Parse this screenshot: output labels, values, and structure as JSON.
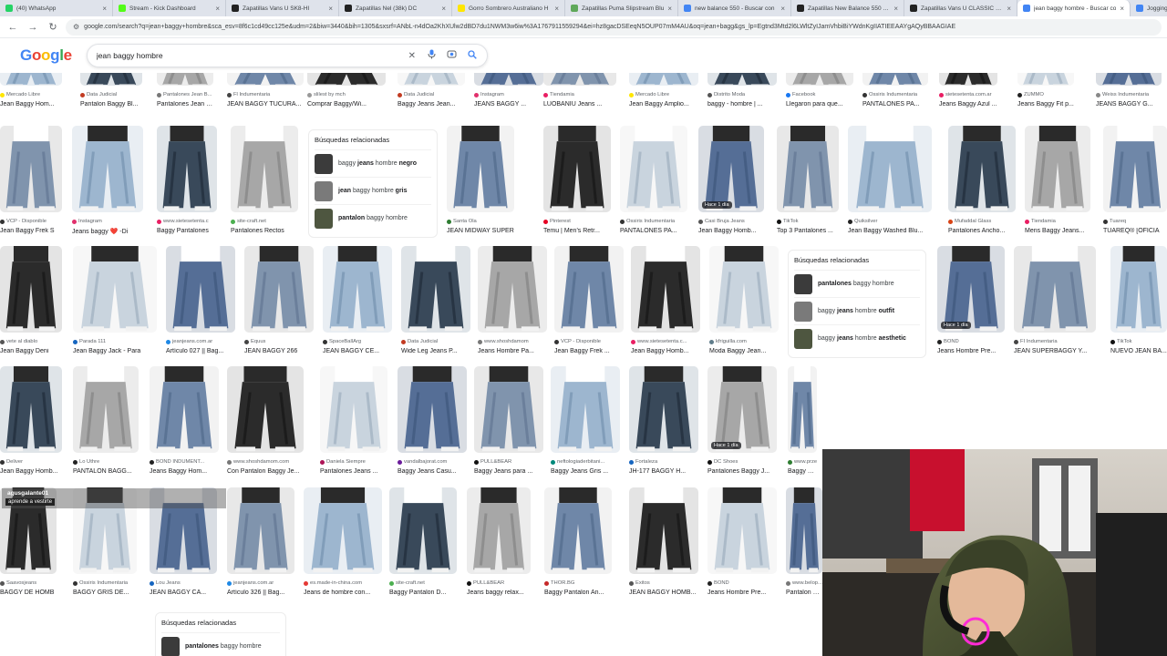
{
  "browser": {
    "tabs": [
      {
        "label": "(40) WhatsApp",
        "color": "#25d366",
        "active": false
      },
      {
        "label": "Stream - Kick Dashboard",
        "color": "#53fc18",
        "active": false
      },
      {
        "label": "Zapatillas Vans U SK8-HI",
        "color": "#222222",
        "active": false
      },
      {
        "label": "Zapatillas Nel (38k) DC",
        "color": "#222222",
        "active": false
      },
      {
        "label": "Gorro Sombrero Australiano H",
        "color": "#ffe600",
        "active": false
      },
      {
        "label": "Zapatillas Puma Slipstream Blu",
        "color": "#5fa85a",
        "active": false
      },
      {
        "label": "new balance 550 - Buscar con",
        "color": "#4285f4",
        "active": false
      },
      {
        "label": "Zapatillas New Balance 550 - B",
        "color": "#222222",
        "active": false
      },
      {
        "label": "Zapatillas Vans U CLASSIC SLI",
        "color": "#222222",
        "active": false
      },
      {
        "label": "jean baggy hombre - Buscar co",
        "color": "#4285f4",
        "active": true
      },
      {
        "label": "Jogging Co",
        "color": "#4285f4",
        "active": false
      }
    ],
    "url": "google.com/search?q=jean+baggy+hombre&sca_esv=8f6c1cd49cc125e&udm=2&biw=3440&bih=1305&sxsrf=ANbL-n4dOa2KhXUlw2dBD7du1NWM3w6iw%3A1767911559294&ei=hz8gacDSEeqN5OUP07mM4AU&oq=jean+bagg&gs_lp=Egtnd3Mtd2l6LWltZyIJamVhbiBiYWdnKgIIATIEEAAYgAQyBBAAGIAE"
  },
  "google": {
    "logo": "Google",
    "query": "jean baggy hombre"
  },
  "related": {
    "heading": "Búsquedas relacionadas",
    "box1": [
      {
        "pre": "baggy ",
        "bold": "jeans",
        "post": " hombre ",
        "bold2": "negro"
      },
      {
        "pre": "",
        "bold": "jean",
        "post": " baggy hombre ",
        "bold2": "gris"
      },
      {
        "pre": "",
        "bold": "pantalon",
        "post": " baggy hombre",
        "bold2": ""
      }
    ],
    "box2": [
      {
        "pre": "",
        "bold": "pantalones",
        "post": " baggy hombre",
        "bold2": ""
      },
      {
        "pre": "baggy ",
        "bold": "jeans",
        "post": " hombre ",
        "bold2": "outfit"
      },
      {
        "pre": "baggy ",
        "bold": "jeans",
        "post": " hombre ",
        "bold2": "aesthetic"
      }
    ],
    "box3": [
      {
        "pre": "",
        "bold": "pantalones",
        "post": " baggy hombre",
        "bold2": ""
      }
    ]
  },
  "rows": [
    [
      {
        "src": "Mercado Libre",
        "title": "Jean Baggy Hom...",
        "dot": "#ffe600"
      },
      {
        "src": "Data Judicial",
        "title": "Pantalon Baggy Bl...",
        "dot": "#c23b22"
      },
      {
        "src": "Pantalones Jean B...",
        "title": "Pantalones Jean B...",
        "dot": "#777777"
      },
      {
        "src": "Fl Indumentaria",
        "title": "JEAN BAGGY TUCURA...",
        "dot": "#444444"
      },
      {
        "src": "slilest by mch",
        "title": "Comprar Baggy/Wi...",
        "dot": "#999999"
      },
      {
        "src": "Data Judicial",
        "title": "Baggy Jeans Jean...",
        "dot": "#c23b22"
      },
      {
        "src": "Instagram",
        "title": "JEANS BAGGY ...",
        "dot": "#e1306c"
      },
      {
        "src": "Tiendamia",
        "title": "LUOBANIU Jeans ...",
        "dot": "#e91e63"
      },
      {
        "src": "Mercado Libre",
        "title": "Jean Baggy Amplio...",
        "dot": "#ffe600"
      },
      {
        "src": "Distrito Moda",
        "title": "baggy - hombre | ...",
        "dot": "#555555"
      },
      {
        "src": "Facebook",
        "title": "Llegaron para que...",
        "dot": "#1877f2"
      },
      {
        "src": "Ossiris Indumentaria",
        "title": "PANTALONES PA...",
        "dot": "#333333"
      },
      {
        "src": "sietesetenta.com.ar",
        "title": "Jeans Baggy Azul ...",
        "dot": "#e91e63"
      },
      {
        "src": "ZUMMO",
        "title": "Jeans Baggy Fit p...",
        "dot": "#222222"
      },
      {
        "src": "Weiss Indumentaria",
        "title": "JEANS BAGGY G...",
        "dot": "#888888"
      }
    ],
    [
      {
        "src": "VCP - Disponible",
        "title": "Jean Baggy Frek S",
        "dot": "#333333"
      },
      {
        "src": "Instagram",
        "title": "Jeans baggy ❤️ -Di",
        "dot": "#e1306c"
      },
      {
        "src": "www.sietesetenta.c",
        "title": "Baggy Pantalones",
        "dot": "#e91e63"
      },
      {
        "src": "site-craft.net",
        "title": "Pantalones Rectos",
        "dot": "#4caf50"
      },
      {
        "src": "Santa Ola",
        "title": "JEAN MIDWAY SUPER",
        "dot": "#2e7d32"
      },
      {
        "src": "Pinterest",
        "title": "Temu | Men's Retr...",
        "dot": "#e60023"
      },
      {
        "src": "Ossiris Indumentaria",
        "title": "PANTALONES PA...",
        "dot": "#333333"
      },
      {
        "src": "Casi Bruja Jeans",
        "title": "Jean Baggy Homb...",
        "dot": "#555555"
      },
      {
        "src": "TikTok",
        "title": "Top 3 Pantalones ...",
        "dot": "#111111"
      },
      {
        "src": "Quiksilver",
        "title": "Jean Baggy Washed Blu...",
        "dot": "#222222"
      },
      {
        "src": "Mufaddal Glass",
        "title": "Pantalones Ancho...",
        "dot": "#d84315"
      },
      {
        "src": "Tiendamia",
        "title": "Mens Baggy Jeans...",
        "dot": "#e91e63"
      },
      {
        "src": "Tuareq",
        "title": "TUAREQ® [OFICIA",
        "dot": "#333333"
      }
    ],
    [
      {
        "src": "vete al diablo",
        "title": "Jean Baggy Deni",
        "dot": "#555555"
      },
      {
        "src": "Parada 111",
        "title": "Jean Baggy Jack - Para",
        "dot": "#1565c0"
      },
      {
        "src": "jeanjeans.com.ar",
        "title": "Artículo 027 || Bag...",
        "dot": "#1e88e5"
      },
      {
        "src": "Equus",
        "title": "JEAN BAGGY 266",
        "dot": "#444444"
      },
      {
        "src": "SpaceBallArg",
        "title": "JEAN BAGGY CE...",
        "dot": "#333333"
      },
      {
        "src": "Data Judicial",
        "title": "Wide Leg Jeans P...",
        "dot": "#c23b22"
      },
      {
        "src": "www.shoshdamom",
        "title": "Jeans Hombre Pa...",
        "dot": "#777777"
      },
      {
        "src": "VCP - Disponible",
        "title": "Jean Baggy Frek ...",
        "dot": "#333333"
      },
      {
        "src": "www.sietesetenta.c...",
        "title": "Jean Baggy Homb...",
        "dot": "#e91e63"
      },
      {
        "src": "kfriguilla.com",
        "title": "Moda Baggy Jean...",
        "dot": "#607d8b"
      },
      {
        "src": "BOND",
        "title": "Jeans Hombre Pre...",
        "dot": "#222222"
      },
      {
        "src": "FI Indumentaria",
        "title": "JEAN SUPERBAGGY Y...",
        "dot": "#444444"
      },
      {
        "src": "TikTok",
        "title": "NUEVO JEAN BA...",
        "dot": "#111111"
      }
    ],
    [
      {
        "src": "Deliver",
        "title": "Jean Baggy Homb...",
        "dot": "#333333"
      },
      {
        "src": "Lo Uthre",
        "title": "PANTALON BAGG...",
        "dot": "#222222"
      },
      {
        "src": "BOND INDUMENT...",
        "title": "Jeans Baggy Hom...",
        "dot": "#222222"
      },
      {
        "src": "www.shoshdamom.com",
        "title": "Con Pantalon Baggy Je...",
        "dot": "#777777"
      },
      {
        "src": "Daniela Siempre",
        "title": "Pantalones Jeans ...",
        "dot": "#ad1457"
      },
      {
        "src": "vandalbajorat.com",
        "title": "Baggy Jeans Casu...",
        "dot": "#6a1b9a"
      },
      {
        "src": "PULL&BEAR",
        "title": "Baggy Jeans para ...",
        "dot": "#111111"
      },
      {
        "src": "neftologiaderbitani...",
        "title": "Baggy Jeans Gris ...",
        "dot": "#00897b"
      },
      {
        "src": "Fortaleza",
        "title": "JH-177 BAGGY H...",
        "dot": "#1565c0"
      },
      {
        "src": "DC Shoes",
        "title": "Pantalones Baggy J...",
        "dot": "#111111"
      },
      {
        "src": "www.prze...",
        "title": "Baggy Jea...",
        "dot": "#2e7d32"
      }
    ],
    [
      {
        "src": "Saavosjeans",
        "title": "BAGGY DE HOMB",
        "dot": "#555555"
      },
      {
        "src": "Ossiris Indumentaria",
        "title": "BAGGY GRIS DE...",
        "dot": "#333333"
      },
      {
        "src": "Lou Jeans",
        "title": "JEAN BAGGY CA...",
        "dot": "#1565c0"
      },
      {
        "src": "jeanjeans.com.ar",
        "title": "Artículo 326 || Bag...",
        "dot": "#1e88e5"
      },
      {
        "src": "es.made-in-china.com",
        "title": "Jeans de hombre con...",
        "dot": "#e53935"
      },
      {
        "src": "site-craft.net",
        "title": "Baggy Pantalon D...",
        "dot": "#4caf50"
      },
      {
        "src": "PULL&BEAR",
        "title": "Jeans baggy relax...",
        "dot": "#111111"
      },
      {
        "src": "THOR.BG",
        "title": "Baggy Pantalon An...",
        "dot": "#c62828"
      },
      {
        "src": "Exitos",
        "title": "JEAN BAGGY HOMB...",
        "dot": "#555555"
      },
      {
        "src": "BOND",
        "title": "Jeans Hombre Pre...",
        "dot": "#222222"
      },
      {
        "src": "www.belop...",
        "title": "Pantalon Ca...",
        "dot": "#777777"
      }
    ]
  ],
  "badges": {
    "hace1dia": "Hace 1 día"
  },
  "stream_overlay": {
    "username": "agusgalante01",
    "subtitle": "aprende a vestirte"
  },
  "colors": {
    "accent": "#1a73e8",
    "tab_active": "#ffffff",
    "tabbar": "#dfe3eb"
  }
}
